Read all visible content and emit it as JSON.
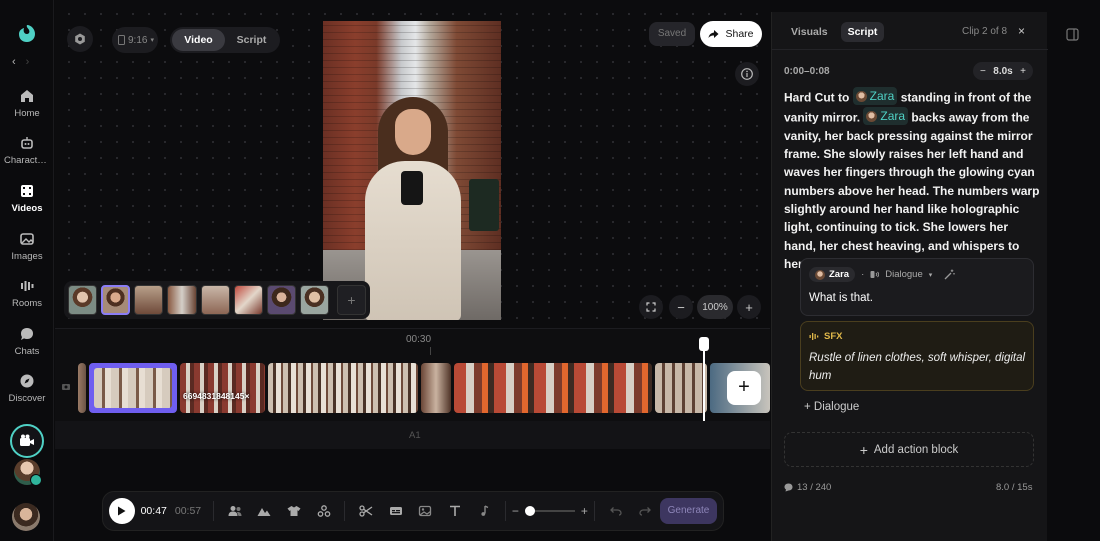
{
  "nav": {
    "items": [
      {
        "label": "Home",
        "icon": "home-icon"
      },
      {
        "label": "Characters",
        "icon": "robot-icon"
      },
      {
        "label": "Videos",
        "icon": "film-icon"
      },
      {
        "label": "Images",
        "icon": "images-icon"
      },
      {
        "label": "Rooms",
        "icon": "bars-icon"
      },
      {
        "label": "Chats",
        "icon": "chat-icon"
      },
      {
        "label": "Discover",
        "icon": "compass-icon"
      }
    ],
    "active": "Videos",
    "back_arrow": "‹",
    "forward_arrow": "›"
  },
  "canvas": {
    "aspect_ratio": "9:16",
    "mode_tabs": [
      "Video",
      "Script"
    ],
    "active_mode": "Video",
    "saved_label": "Saved",
    "share_label": "Share",
    "zoom_level": "100%"
  },
  "timeline": {
    "ruler_label": "00:30",
    "clip_label": "6694831848145×",
    "audio_track_label": "A1",
    "add_clip_label": "+"
  },
  "toolbar": {
    "current_time": "00:47",
    "total_time": "00:57",
    "generate_label": "Generate"
  },
  "panel": {
    "tabs": [
      "Visuals",
      "Script"
    ],
    "active_tab": "Script",
    "clip_counter": "Clip 2 of 8",
    "close_label": "×",
    "time_range": "0:00–0:08",
    "duration": "8.0s",
    "script_parts": {
      "p1": "Hard Cut to",
      "mention": "Zara",
      "p2": "standing in front of the vanity mirror.",
      "p3": "backs away from the vanity, her back pressing against the mirror frame. She slowly raises her left hand and waves her fingers through the glowing cyan numbers above her head. The numbers warp slightly around her hand like holographic light, continuing to tick. She lowers her hand, her chest heaving, and whispers to herself."
    },
    "dialogue_block": {
      "speaker": "Zara",
      "type_label": "Dialogue",
      "text": "What is that."
    },
    "sfx_block": {
      "label": "SFX",
      "text": "Rustle of linen clothes, soft whisper, digital hum"
    },
    "add_dialogue_label": "+ Dialogue",
    "add_action_label": "Add action block",
    "char_count": "13 / 240",
    "time_count": "8.0 / 15s"
  },
  "colors": {
    "accent_teal": "#4fd1c5",
    "selection_purple": "#6f5ef0",
    "sfx_gold": "#e0b84a",
    "generate_purple": "#3d3660"
  }
}
